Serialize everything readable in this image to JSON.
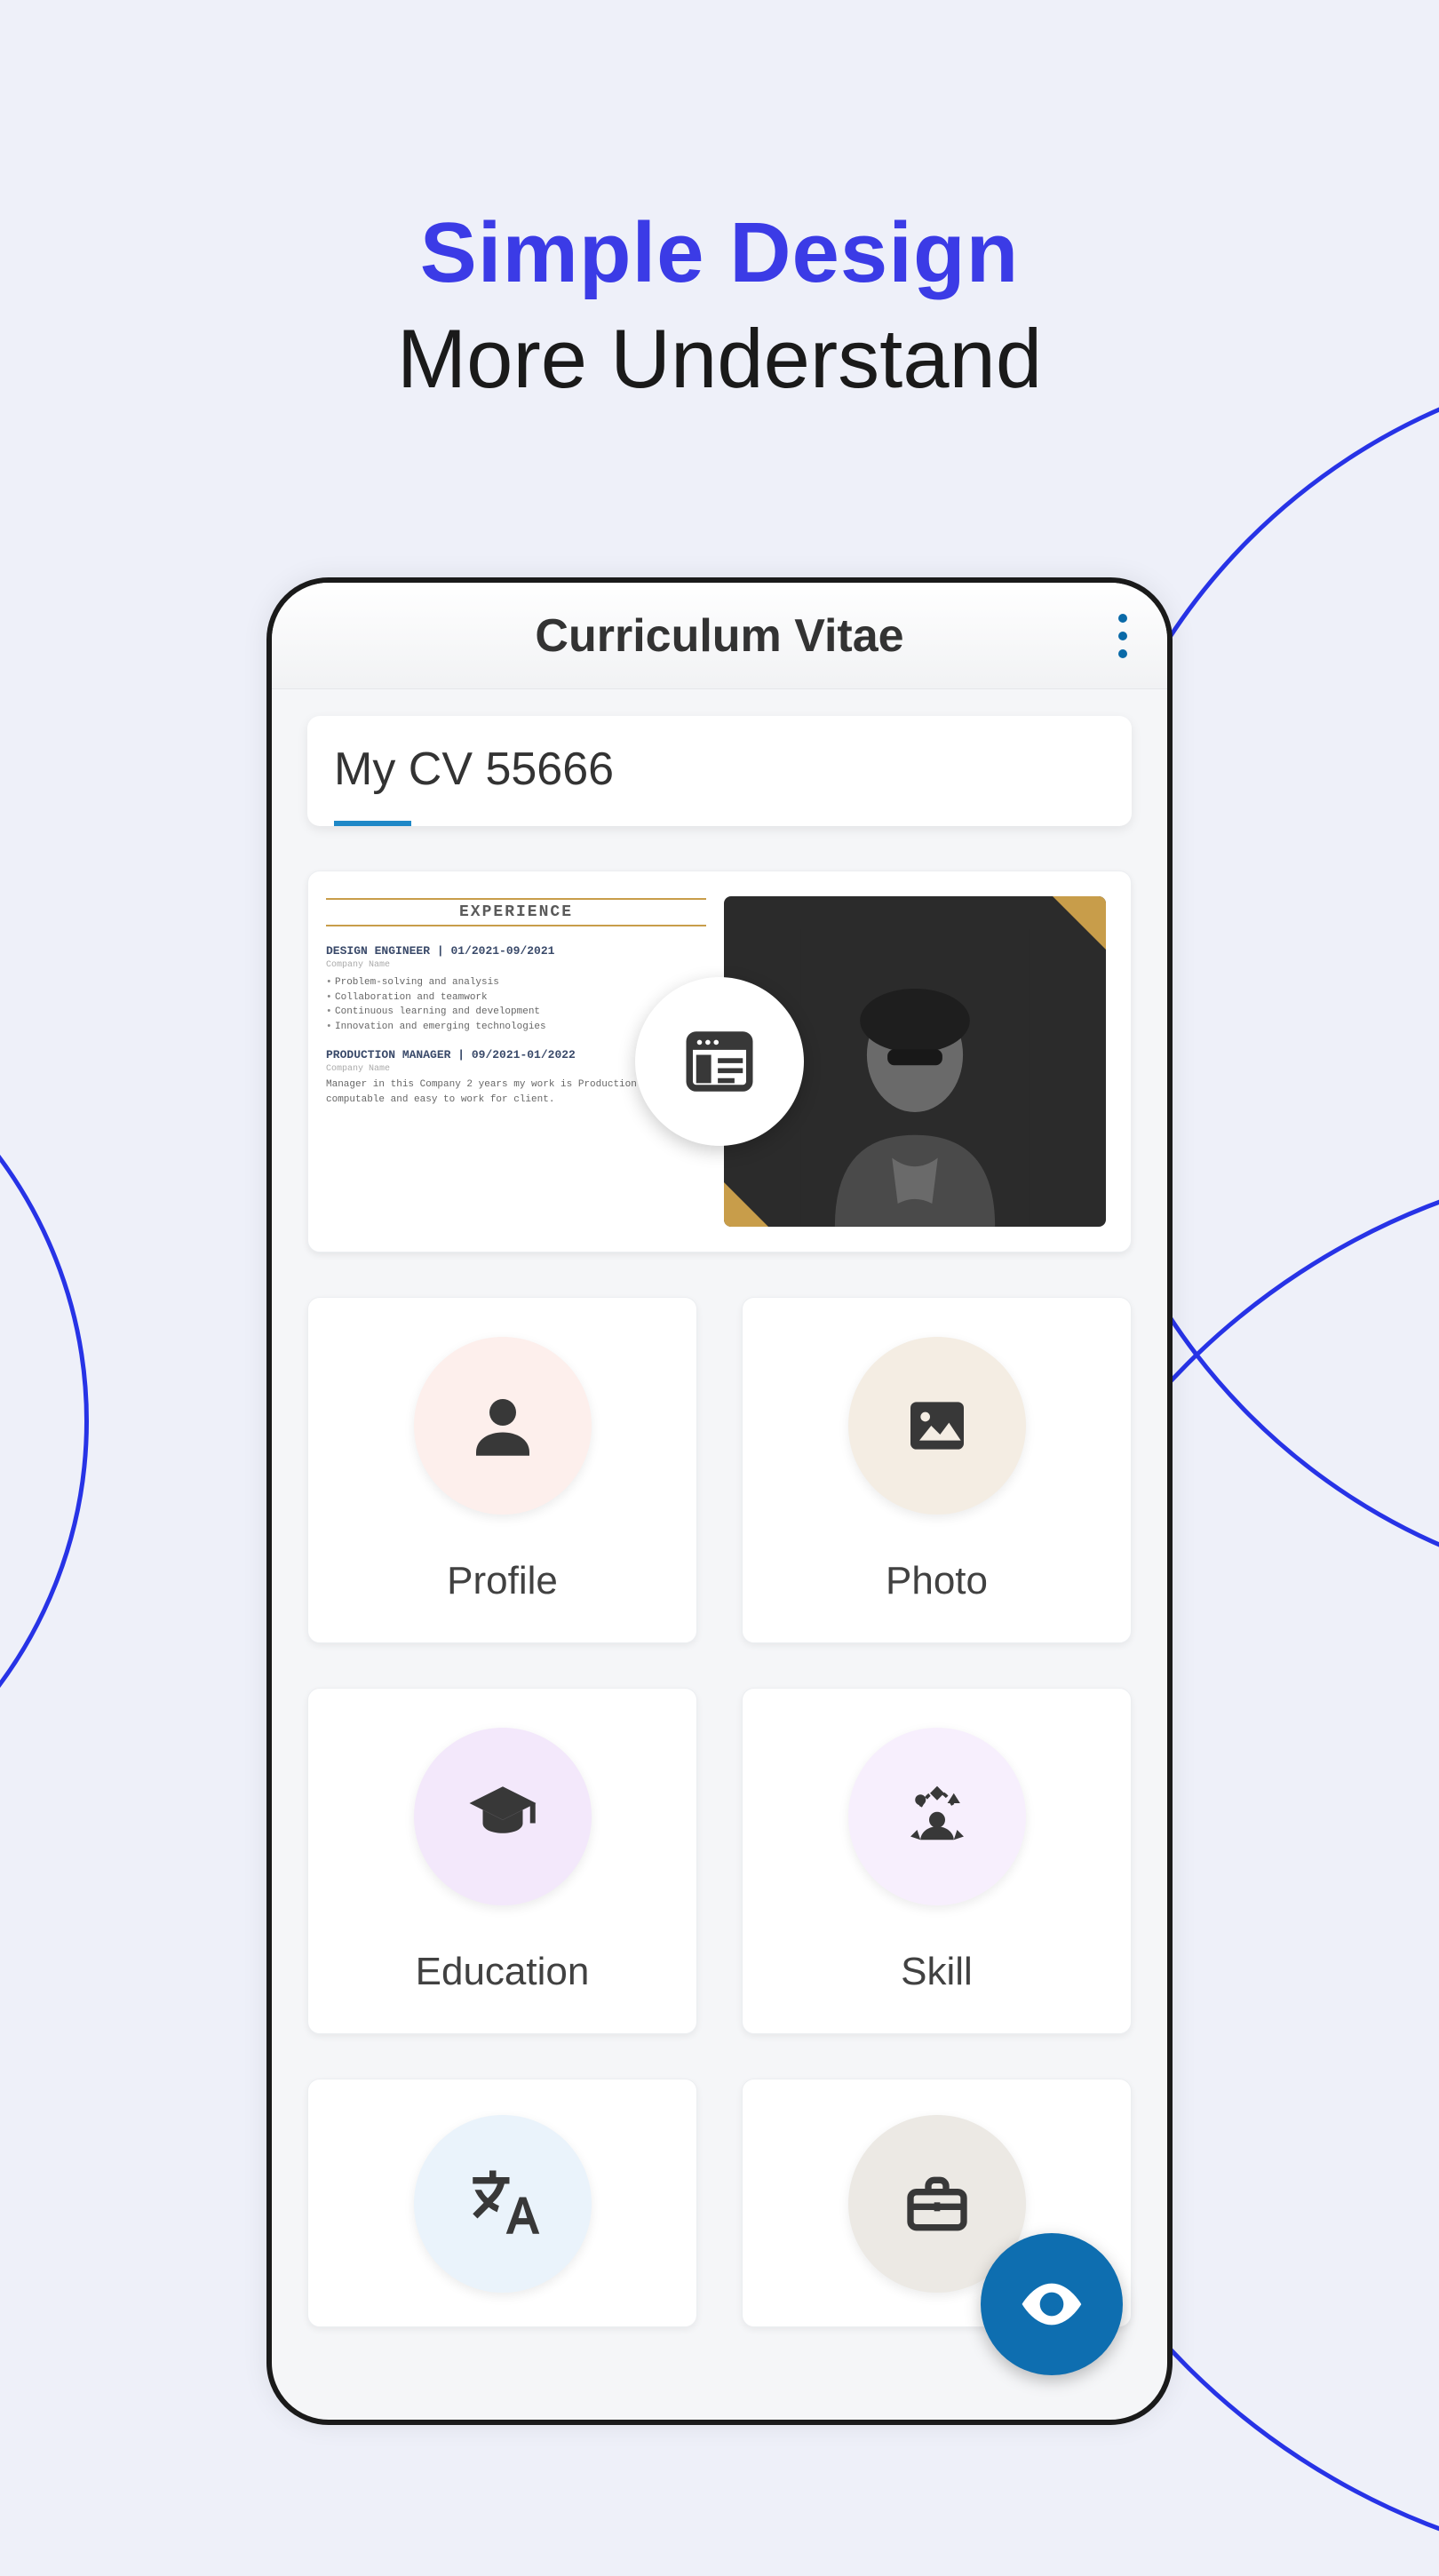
{
  "headline": {
    "line1": "Simple Design",
    "line2": "More Understand"
  },
  "app": {
    "title": "Curriculum Vitae",
    "cv_name": "My CV 55666"
  },
  "preview": {
    "section_heading": "EXPERIENCE",
    "jobs": [
      {
        "title": "DESIGN ENGINEER",
        "dates": "01/2021-09/2021",
        "company": "Company Name",
        "bullets": [
          "Problem-solving and analysis",
          "Collaboration and teamwork",
          "Continuous learning and development",
          "Innovation and emerging technologies"
        ]
      },
      {
        "title": "PRODUCTION MANAGER",
        "dates": "09/2021-01/2022",
        "company": "Company Name",
        "desc": "Manager in this Company 2 years my work is Production more computable and easy to work for client."
      }
    ]
  },
  "tiles": [
    {
      "label": "Profile",
      "icon": "person-icon",
      "bg": "bg-pink"
    },
    {
      "label": "Photo",
      "icon": "image-icon",
      "bg": "bg-tan"
    },
    {
      "label": "Education",
      "icon": "graduation-icon",
      "bg": "bg-violet"
    },
    {
      "label": "Skill",
      "icon": "juggle-icon",
      "bg": "bg-purple"
    },
    {
      "label": "",
      "icon": "translate-icon",
      "bg": "bg-blue"
    },
    {
      "label": "",
      "icon": "briefcase-icon",
      "bg": "bg-gray"
    }
  ]
}
